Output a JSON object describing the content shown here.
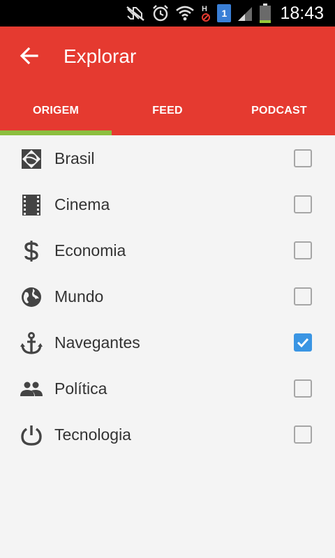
{
  "status_bar": {
    "time": "18:43",
    "icons": [
      "mute-icon",
      "alarm-icon",
      "wifi-icon",
      "no-signal-h-icon",
      "sim-1-icon",
      "signal-icon",
      "battery-icon"
    ],
    "sim_label": "1",
    "network_label": "H"
  },
  "app_bar": {
    "title": "Explorar",
    "back_icon": "arrow-back-icon",
    "background_color": "#e53a30"
  },
  "tabs": [
    {
      "label": "ORIGEM",
      "selected": true
    },
    {
      "label": "FEED",
      "selected": false
    },
    {
      "label": "PODCAST",
      "selected": false
    }
  ],
  "tab_indicator_color": "#8cbf3f",
  "items": [
    {
      "label": "Brasil",
      "icon": "brasil-flag-icon",
      "checked": false
    },
    {
      "label": "Cinema",
      "icon": "film-icon",
      "checked": false
    },
    {
      "label": "Economia",
      "icon": "dollar-icon",
      "checked": false
    },
    {
      "label": "Mundo",
      "icon": "globe-icon",
      "checked": false
    },
    {
      "label": "Navegantes",
      "icon": "anchor-icon",
      "checked": true
    },
    {
      "label": "Política",
      "icon": "people-icon",
      "checked": false
    },
    {
      "label": "Tecnologia",
      "icon": "power-icon",
      "checked": false
    }
  ],
  "checkbox_checked_color": "#3a95e3"
}
